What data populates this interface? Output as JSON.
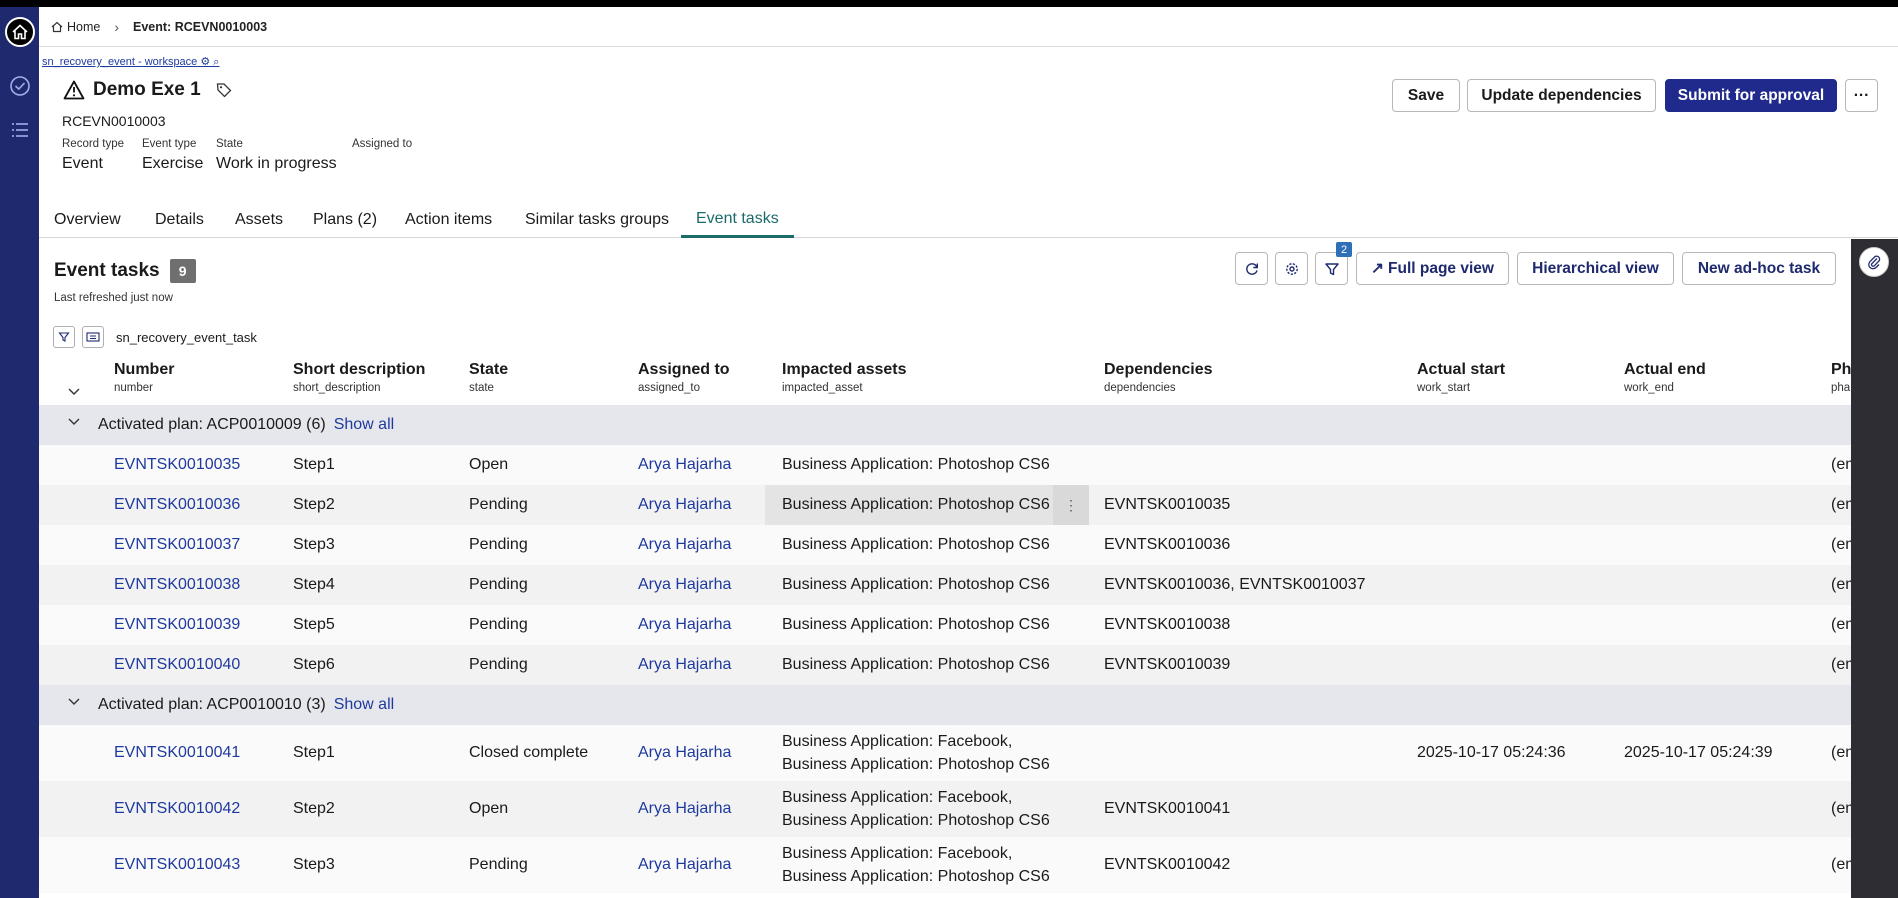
{
  "breadcrumb": {
    "home": "Home",
    "current": "Event: RCEVN0010003"
  },
  "workspace_link": "sn_recovery_event - workspace",
  "header": {
    "title": "Demo Exe 1",
    "record_number": "RCEVN0010003",
    "meta": [
      {
        "label": "Record type",
        "value": "Event"
      },
      {
        "label": "Event type",
        "value": "Exercise"
      },
      {
        "label": "State",
        "value": "Work in progress"
      },
      {
        "label": "Assigned to",
        "value": ""
      }
    ],
    "buttons": {
      "save": "Save",
      "update_deps": "Update dependencies",
      "submit": "Submit for approval",
      "more": "···"
    }
  },
  "tabs": [
    "Overview",
    "Details",
    "Assets",
    "Plans (2)",
    "Action items",
    "Similar tasks groups",
    "Event tasks"
  ],
  "active_tab": "Event tasks",
  "section": {
    "title": "Event tasks",
    "count": "9",
    "refreshed": "Last refreshed just now",
    "filter_badge": "2",
    "table_name": "sn_recovery_event_task",
    "buttons": {
      "full_page": "Full page view",
      "hierarchical": "Hierarchical view",
      "new_task": "New ad-hoc task"
    }
  },
  "columns": [
    {
      "label": "Number",
      "field": "number"
    },
    {
      "label": "Short description",
      "field": "short_description"
    },
    {
      "label": "State",
      "field": "state"
    },
    {
      "label": "Assigned to",
      "field": "assigned_to"
    },
    {
      "label": "Impacted assets",
      "field": "impacted_asset"
    },
    {
      "label": "Dependencies",
      "field": "dependencies"
    },
    {
      "label": "Actual start",
      "field": "work_start"
    },
    {
      "label": "Actual end",
      "field": "work_end"
    },
    {
      "label": "Pha",
      "field": "pha"
    }
  ],
  "groups": [
    {
      "label": "Activated plan: ACP0010009 (6)",
      "show_all": "Show all",
      "rows": [
        {
          "number": "EVNTSK0010035",
          "desc": "Step1",
          "state": "Open",
          "assigned": "Arya Hajarha",
          "assets": [
            "Business Application: Photoshop CS6"
          ],
          "deps": "",
          "start": "",
          "end": "",
          "pha": "(em"
        },
        {
          "number": "EVNTSK0010036",
          "desc": "Step2",
          "state": "Pending",
          "assigned": "Arya Hajarha",
          "assets": [
            "Business Application: Photoshop CS6"
          ],
          "deps": "EVNTSK0010035",
          "start": "",
          "end": "",
          "pha": "(em"
        },
        {
          "number": "EVNTSK0010037",
          "desc": "Step3",
          "state": "Pending",
          "assigned": "Arya Hajarha",
          "assets": [
            "Business Application: Photoshop CS6"
          ],
          "deps": "EVNTSK0010036",
          "start": "",
          "end": "",
          "pha": "(em"
        },
        {
          "number": "EVNTSK0010038",
          "desc": "Step4",
          "state": "Pending",
          "assigned": "Arya Hajarha",
          "assets": [
            "Business Application: Photoshop CS6"
          ],
          "deps": "EVNTSK0010036, EVNTSK0010037",
          "start": "",
          "end": "",
          "pha": "(em"
        },
        {
          "number": "EVNTSK0010039",
          "desc": "Step5",
          "state": "Pending",
          "assigned": "Arya Hajarha",
          "assets": [
            "Business Application: Photoshop CS6"
          ],
          "deps": "EVNTSK0010038",
          "start": "",
          "end": "",
          "pha": "(em"
        },
        {
          "number": "EVNTSK0010040",
          "desc": "Step6",
          "state": "Pending",
          "assigned": "Arya Hajarha",
          "assets": [
            "Business Application: Photoshop CS6"
          ],
          "deps": "EVNTSK0010039",
          "start": "",
          "end": "",
          "pha": "(em"
        }
      ]
    },
    {
      "label": "Activated plan: ACP0010010 (3)",
      "show_all": "Show all",
      "rows": [
        {
          "number": "EVNTSK0010041",
          "desc": "Step1",
          "state": "Closed complete",
          "assigned": "Arya Hajarha",
          "assets": [
            "Business Application: Facebook,",
            "Business Application: Photoshop CS6"
          ],
          "deps": "",
          "start": "2025-10-17 05:24:36",
          "end": "2025-10-17 05:24:39",
          "pha": "(em"
        },
        {
          "number": "EVNTSK0010042",
          "desc": "Step2",
          "state": "Open",
          "assigned": "Arya Hajarha",
          "assets": [
            "Business Application: Facebook,",
            "Business Application: Photoshop CS6"
          ],
          "deps": "EVNTSK0010041",
          "start": "",
          "end": "",
          "pha": "(em"
        },
        {
          "number": "EVNTSK0010043",
          "desc": "Step3",
          "state": "Pending",
          "assigned": "Arya Hajarha",
          "assets": [
            "Business Application: Facebook,",
            "Business Application: Photoshop CS6"
          ],
          "deps": "EVNTSK0010042",
          "start": "",
          "end": "",
          "pha": "(em"
        }
      ]
    }
  ],
  "colors": {
    "nav": "#1f2a6e",
    "primary": "#1f2a8c",
    "link": "#1f3a9e",
    "active_tab": "#1b6b6b"
  }
}
